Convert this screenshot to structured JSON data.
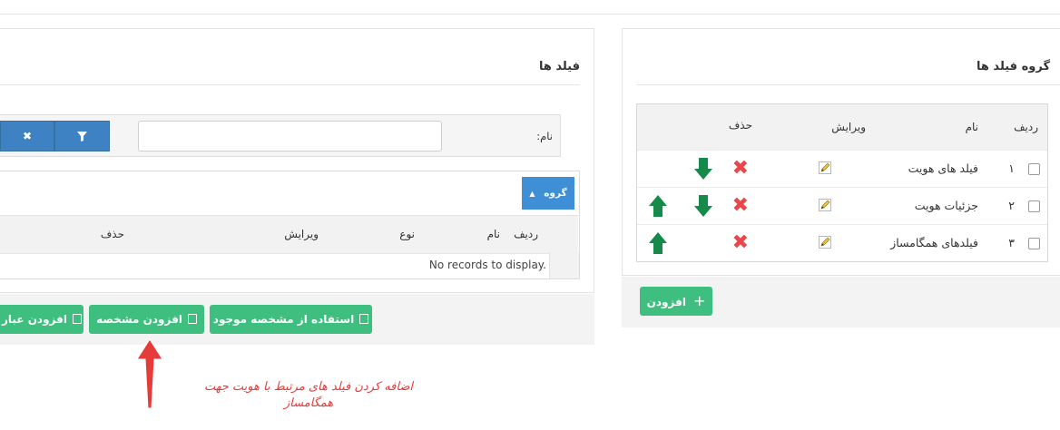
{
  "right_panel": {
    "title": "گروه فیلد ها",
    "headers": {
      "row": "ردیف",
      "name": "نام",
      "edit": "ویرایش",
      "delete": "حذف"
    },
    "rows": [
      {
        "num": "۱",
        "name": "فیلد های هویت",
        "up": false,
        "down": true
      },
      {
        "num": "۲",
        "name": "جزئیات هویت",
        "up": true,
        "down": true
      },
      {
        "num": "۳",
        "name": "فیلدهای همگامساز",
        "up": true,
        "down": false
      }
    ],
    "add_button": "افزودن"
  },
  "left_panel": {
    "title": "فیلد ها",
    "filter_label": "نام:",
    "name_input_value": "",
    "group_button": "گروه",
    "headers": {
      "row": "ردیف",
      "name": "نام",
      "type": "نوع",
      "edit": "ویرایش",
      "delete": "حذف"
    },
    "no_records": "No records to display.",
    "buttons": {
      "use_existing": "استفاده از مشخصه موجود",
      "add_property": "افزودن مشخصه",
      "add_expression": "افزودن عبار"
    }
  },
  "annotation": {
    "line1": "اضافه کردن فیلد های مرتبط با هویت جهت",
    "line2": "همگامساز"
  },
  "colors": {
    "green_button": "#3fbf7f",
    "blue_button": "#3f82c4",
    "delete_red": "#e8474b",
    "arrow_green": "#168a4a",
    "annotation_red": "#e63b3b"
  }
}
